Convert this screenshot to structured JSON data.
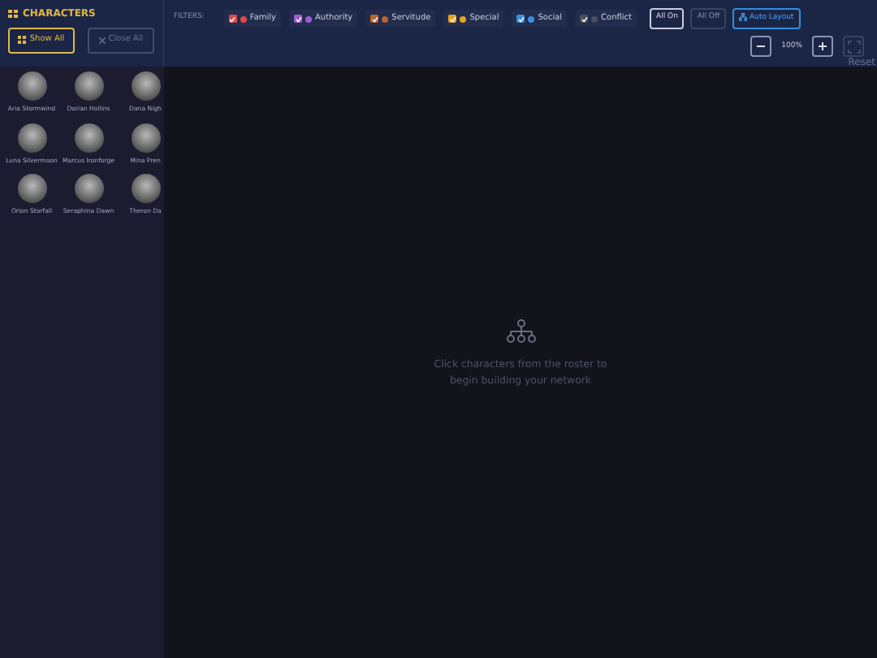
{
  "sidebar": {
    "title": "CHARACTERS",
    "buttons": [
      {
        "label": "Show All",
        "kind": "primary"
      },
      {
        "label": "Close All",
        "kind": "secondary"
      }
    ],
    "characters": [
      {
        "name": "Aria Stormwind"
      },
      {
        "name": "Dorian Hollins"
      },
      {
        "name": "Dana Nigh"
      },
      {
        "name": "Luna Silvermoon"
      },
      {
        "name": "Marcus Ironforge"
      },
      {
        "name": "Mina Pren"
      },
      {
        "name": "Orion Starfall"
      },
      {
        "name": "Seraphina Dawn"
      },
      {
        "name": "Theron Da"
      }
    ]
  },
  "toolbar": {
    "filters_label": "FILTERS:",
    "filters": [
      {
        "label": "Family",
        "checked": true,
        "color": "#e04848"
      },
      {
        "label": "Authority",
        "checked": true,
        "color": "#a05ad6"
      },
      {
        "label": "Servitude",
        "checked": true,
        "color": "#b8642a"
      },
      {
        "label": "Special",
        "checked": true,
        "color": "#e8a21e"
      },
      {
        "label": "Social",
        "checked": true,
        "color": "#3a8ee0"
      },
      {
        "label": "Conflict",
        "checked": true,
        "color": "#4a4f5c"
      }
    ],
    "buttons": [
      {
        "label": "All On",
        "disabled": false
      },
      {
        "label": "All Off",
        "disabled": true
      },
      {
        "label": "Auto Layout",
        "disabled": false
      }
    ],
    "zoom": {
      "value": "100%",
      "reset_label": "Reset"
    }
  },
  "canvas": {
    "empty_message": "Click characters from the roster to begin building your network"
  }
}
